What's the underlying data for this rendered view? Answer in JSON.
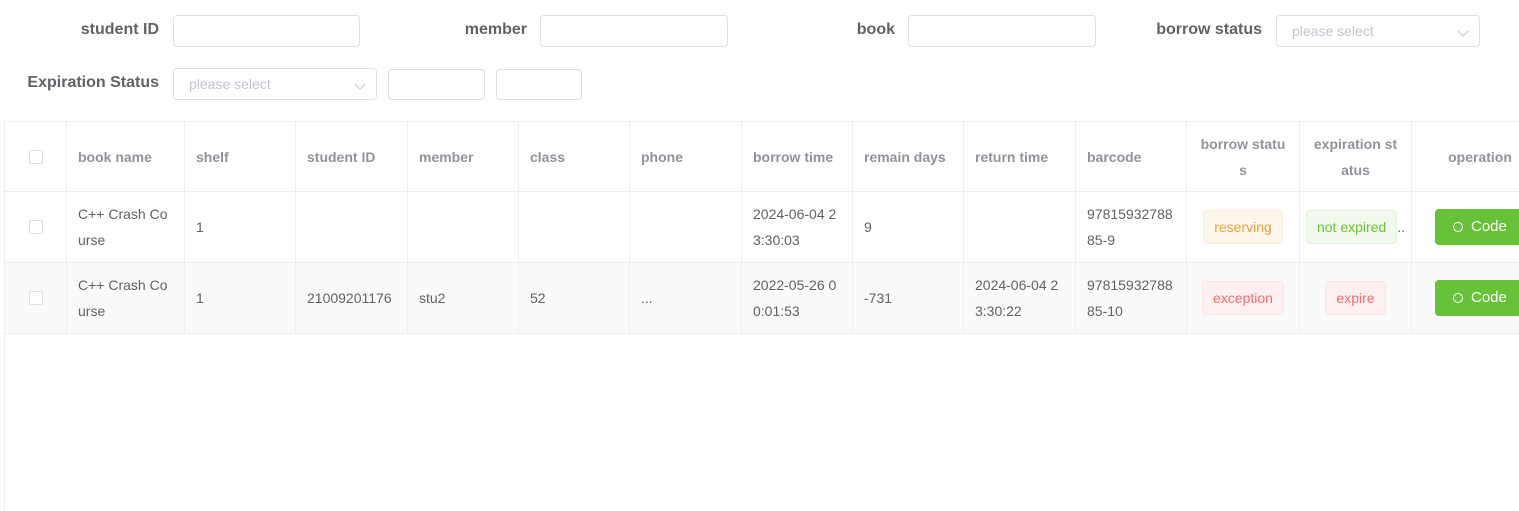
{
  "filters": {
    "student_id_label": "student ID",
    "member_label": "member",
    "book_label": "book",
    "borrow_status_label": "borrow status",
    "borrow_status_placeholder": "please select",
    "expiration_status_label": "Expiration Status",
    "expiration_status_placeholder": "please select"
  },
  "table": {
    "headers": [
      "book name",
      "shelf",
      "student ID",
      "member",
      "class",
      "phone",
      "borrow time",
      "remain days",
      "return time",
      "barcode",
      "borrow status",
      "expiration status",
      "operation"
    ],
    "rows": [
      {
        "book_name": "C++ Crash Course",
        "shelf": "1",
        "student_id": "",
        "member": "",
        "class": "",
        "phone": "",
        "borrow_time": "2024-06-04 23:30:03",
        "remain_days": "9",
        "return_time": "",
        "barcode": "9781593278885-9",
        "borrow_status": "reserving",
        "expiration_status": "not expired",
        "expiration_overflow": "..",
        "operation": "Code"
      },
      {
        "book_name": "C++ Crash Course",
        "shelf": "1",
        "student_id": "21009201176",
        "member": "stu2",
        "class": "52",
        "phone": "...",
        "borrow_time": "2022-05-26 00:01:53",
        "remain_days": "-731",
        "return_time": "2024-06-04 23:30:22",
        "barcode": "9781593278885-10",
        "borrow_status": "exception",
        "expiration_status": "expire",
        "expiration_overflow": "",
        "operation": "Code"
      }
    ]
  },
  "colors": {
    "success": "#67c23a",
    "warning": "#e6a23c",
    "danger": "#f56c6c",
    "header_text": "#909399",
    "body_text": "#606266"
  },
  "icons": {
    "operation_button": "code-icon"
  }
}
